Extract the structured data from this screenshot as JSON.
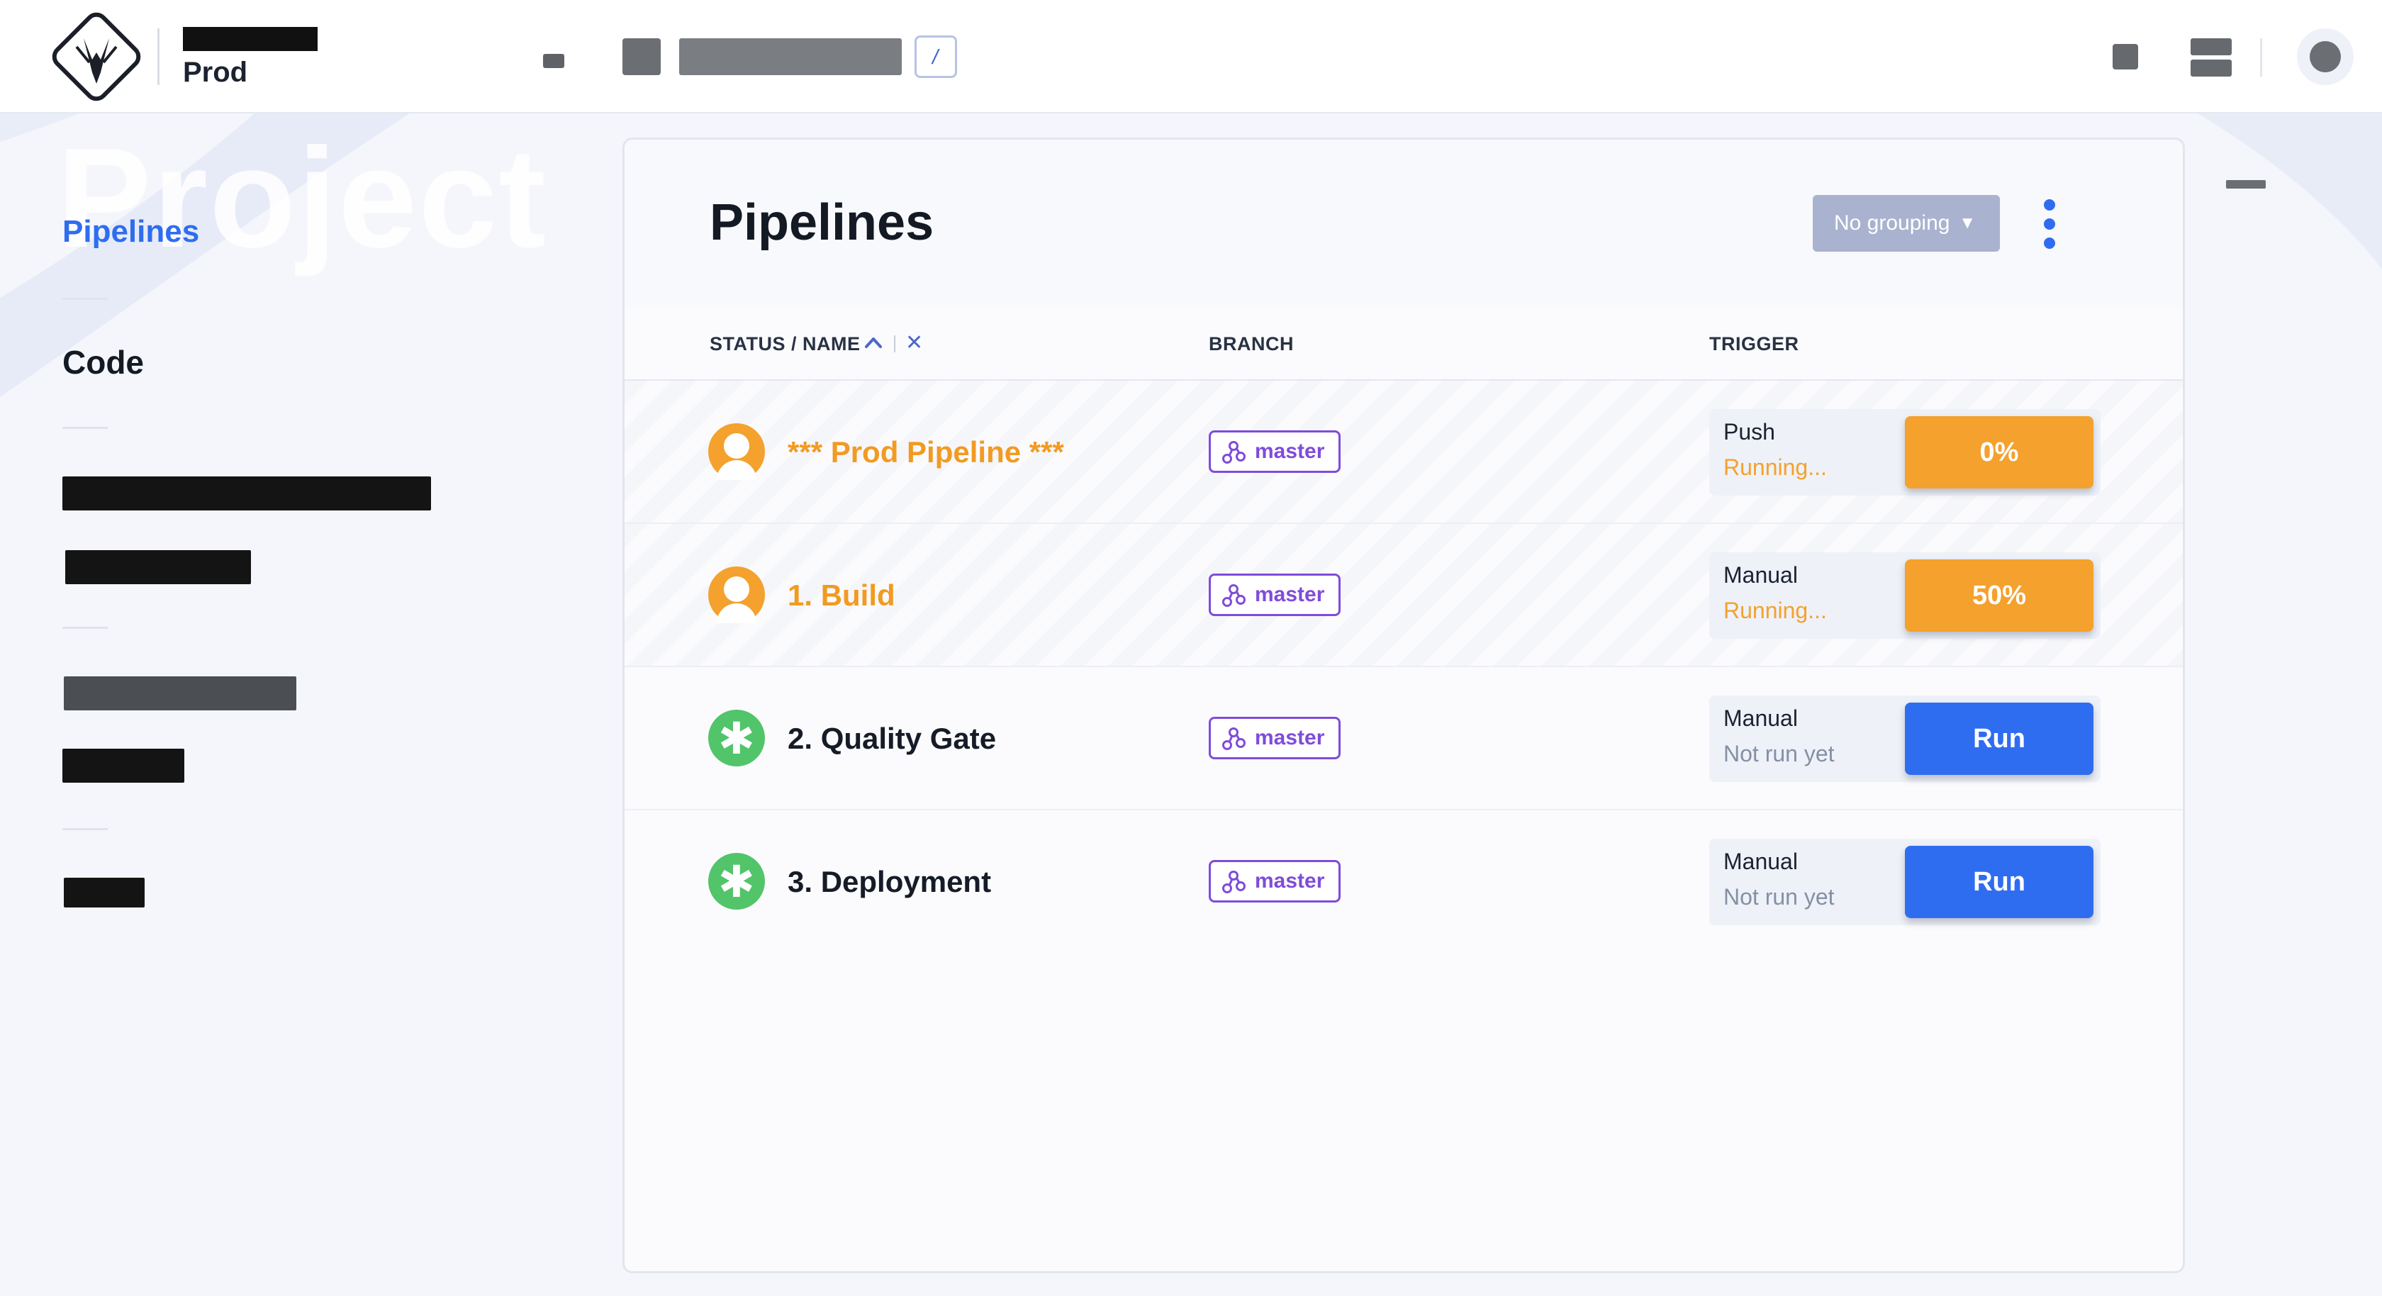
{
  "header": {
    "org_name": "Prod",
    "crumb_separator": "/"
  },
  "sidebar": {
    "watermark": "Project",
    "items": [
      {
        "label": "Pipelines",
        "active": true
      },
      {
        "label": "Code",
        "active": false
      }
    ]
  },
  "main": {
    "title": "Pipelines",
    "grouping": {
      "label": "No grouping",
      "arrow": "▼"
    },
    "columns": {
      "status_name": "STATUS / NAME",
      "branch": "BRANCH",
      "trigger": "TRIGGER",
      "sort_clear": "✕"
    },
    "pipelines": [
      {
        "name": "*** Prod Pipeline ***",
        "status": "running",
        "branch": "master",
        "trigger": "Push",
        "state": "Running...",
        "action": "0%",
        "progress": 0
      },
      {
        "name": "1. Build",
        "status": "running",
        "branch": "master",
        "trigger": "Manual",
        "state": "Running...",
        "action": "50%",
        "progress": 0.5
      },
      {
        "name": "2. Quality Gate",
        "status": "idle",
        "branch": "master",
        "trigger": "Manual",
        "state": "Not run yet",
        "action": "Run"
      },
      {
        "name": "3. Deployment",
        "status": "idle",
        "branch": "master",
        "trigger": "Manual",
        "state": "Not run yet",
        "action": "Run"
      }
    ],
    "idle_status_glyph": "✱"
  },
  "colors": {
    "accent": "#2f6df0",
    "running": "#f4a12d",
    "success": "#52c46a",
    "branch": "#7f4cd9",
    "grouping_bg": "#a9b3cf"
  },
  "icons": {
    "logo": "horned-head-logo",
    "sort": "chevron-up-icon",
    "branch": "branch-icon",
    "menu": "kebab-menu-icon",
    "running_status": "person-running-icon",
    "idle_status": "asterisk-icon"
  }
}
